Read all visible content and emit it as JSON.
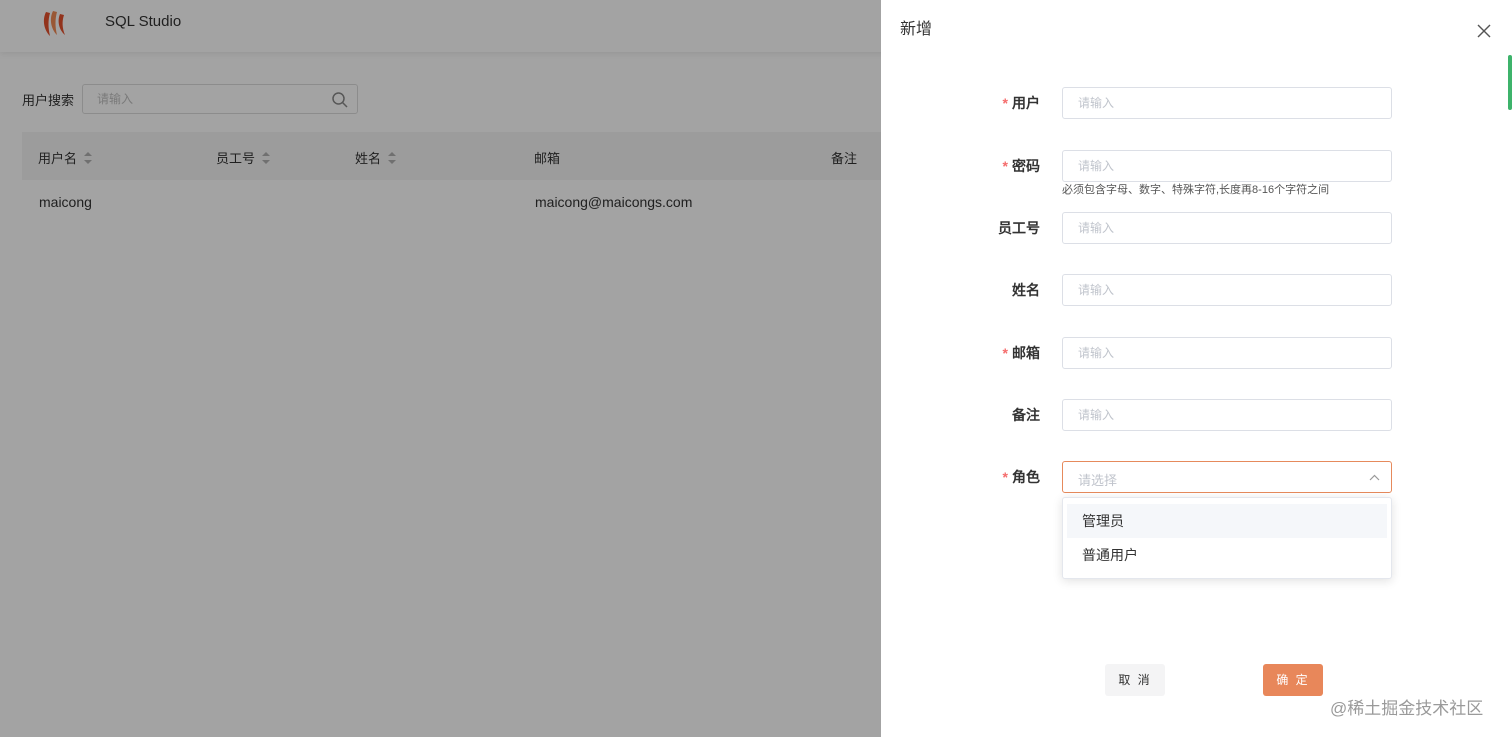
{
  "app": {
    "title": "SQL Studio",
    "search": {
      "label": "用户搜索",
      "placeholder": "请输入"
    },
    "table": {
      "headers": {
        "username": "用户名",
        "employee_no": "员工号",
        "name": "姓名",
        "email": "邮箱",
        "remark": "备注"
      },
      "rows": [
        {
          "username": "maicong",
          "employee_no": "",
          "name": "",
          "email": "maicong@maicongs.com",
          "remark": ""
        }
      ]
    }
  },
  "drawer": {
    "title": "新增",
    "form": {
      "user": {
        "label": "用户",
        "placeholder": "请输入",
        "required": true
      },
      "password": {
        "label": "密码",
        "placeholder": "请输入",
        "required": true,
        "hint": "必须包含字母、数字、特殊字符,长度再8-16个字符之间"
      },
      "employee_no": {
        "label": "员工号",
        "placeholder": "请输入"
      },
      "name": {
        "label": "姓名",
        "placeholder": "请输入"
      },
      "email": {
        "label": "邮箱",
        "placeholder": "请输入",
        "required": true
      },
      "remark": {
        "label": "备注",
        "placeholder": "请输入"
      },
      "role": {
        "label": "角色",
        "placeholder": "请选择",
        "required": true,
        "options": [
          "管理员",
          "普通用户"
        ]
      }
    },
    "buttons": {
      "cancel": "取 消",
      "ok": "确 定"
    }
  },
  "watermark": "@稀土掘金技术社区",
  "colors": {
    "accent": "#e8875a",
    "required": "#f56c6c",
    "edge_tab": "#3db36b"
  }
}
